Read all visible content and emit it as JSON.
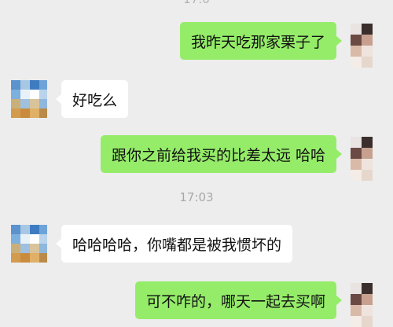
{
  "top_time_partial": "17:0",
  "messages": [
    {
      "side": "out",
      "text": "我昨天吃那家栗子了"
    },
    {
      "side": "in",
      "text": "好吃么"
    },
    {
      "side": "out",
      "text": "跟你之前给我买的比差太远 哈哈"
    },
    {
      "side": "in",
      "text": "哈哈哈哈，你嘴都是被我惯坏的"
    },
    {
      "side": "out",
      "text": "可不咋的，哪天一起去买啊"
    }
  ],
  "timestamp": "17:03",
  "colors": {
    "outgoing_bubble": "#95ec69",
    "incoming_bubble": "#ffffff",
    "background": "#ededed"
  }
}
